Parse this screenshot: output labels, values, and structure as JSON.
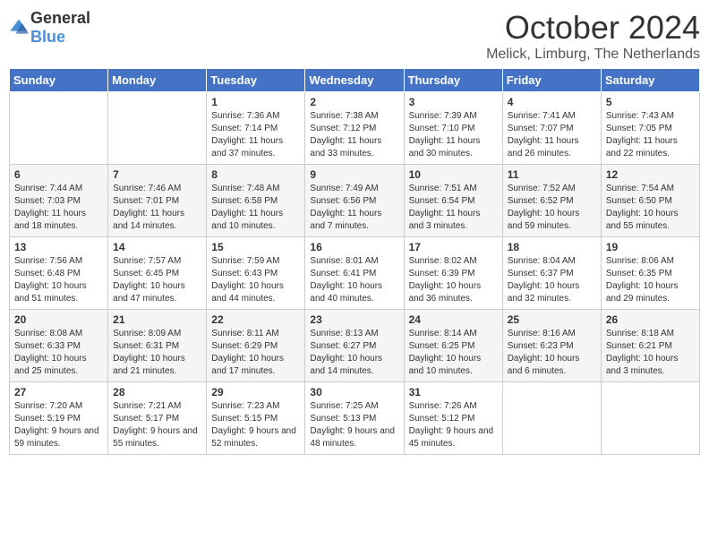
{
  "logo": {
    "general": "General",
    "blue": "Blue"
  },
  "header": {
    "month": "October 2024",
    "location": "Melick, Limburg, The Netherlands"
  },
  "weekdays": [
    "Sunday",
    "Monday",
    "Tuesday",
    "Wednesday",
    "Thursday",
    "Friday",
    "Saturday"
  ],
  "weeks": [
    [
      {
        "day": "",
        "sunrise": "",
        "sunset": "",
        "daylight": ""
      },
      {
        "day": "",
        "sunrise": "",
        "sunset": "",
        "daylight": ""
      },
      {
        "day": "1",
        "sunrise": "Sunrise: 7:36 AM",
        "sunset": "Sunset: 7:14 PM",
        "daylight": "Daylight: 11 hours and 37 minutes."
      },
      {
        "day": "2",
        "sunrise": "Sunrise: 7:38 AM",
        "sunset": "Sunset: 7:12 PM",
        "daylight": "Daylight: 11 hours and 33 minutes."
      },
      {
        "day": "3",
        "sunrise": "Sunrise: 7:39 AM",
        "sunset": "Sunset: 7:10 PM",
        "daylight": "Daylight: 11 hours and 30 minutes."
      },
      {
        "day": "4",
        "sunrise": "Sunrise: 7:41 AM",
        "sunset": "Sunset: 7:07 PM",
        "daylight": "Daylight: 11 hours and 26 minutes."
      },
      {
        "day": "5",
        "sunrise": "Sunrise: 7:43 AM",
        "sunset": "Sunset: 7:05 PM",
        "daylight": "Daylight: 11 hours and 22 minutes."
      }
    ],
    [
      {
        "day": "6",
        "sunrise": "Sunrise: 7:44 AM",
        "sunset": "Sunset: 7:03 PM",
        "daylight": "Daylight: 11 hours and 18 minutes."
      },
      {
        "day": "7",
        "sunrise": "Sunrise: 7:46 AM",
        "sunset": "Sunset: 7:01 PM",
        "daylight": "Daylight: 11 hours and 14 minutes."
      },
      {
        "day": "8",
        "sunrise": "Sunrise: 7:48 AM",
        "sunset": "Sunset: 6:58 PM",
        "daylight": "Daylight: 11 hours and 10 minutes."
      },
      {
        "day": "9",
        "sunrise": "Sunrise: 7:49 AM",
        "sunset": "Sunset: 6:56 PM",
        "daylight": "Daylight: 11 hours and 7 minutes."
      },
      {
        "day": "10",
        "sunrise": "Sunrise: 7:51 AM",
        "sunset": "Sunset: 6:54 PM",
        "daylight": "Daylight: 11 hours and 3 minutes."
      },
      {
        "day": "11",
        "sunrise": "Sunrise: 7:52 AM",
        "sunset": "Sunset: 6:52 PM",
        "daylight": "Daylight: 10 hours and 59 minutes."
      },
      {
        "day": "12",
        "sunrise": "Sunrise: 7:54 AM",
        "sunset": "Sunset: 6:50 PM",
        "daylight": "Daylight: 10 hours and 55 minutes."
      }
    ],
    [
      {
        "day": "13",
        "sunrise": "Sunrise: 7:56 AM",
        "sunset": "Sunset: 6:48 PM",
        "daylight": "Daylight: 10 hours and 51 minutes."
      },
      {
        "day": "14",
        "sunrise": "Sunrise: 7:57 AM",
        "sunset": "Sunset: 6:45 PM",
        "daylight": "Daylight: 10 hours and 47 minutes."
      },
      {
        "day": "15",
        "sunrise": "Sunrise: 7:59 AM",
        "sunset": "Sunset: 6:43 PM",
        "daylight": "Daylight: 10 hours and 44 minutes."
      },
      {
        "day": "16",
        "sunrise": "Sunrise: 8:01 AM",
        "sunset": "Sunset: 6:41 PM",
        "daylight": "Daylight: 10 hours and 40 minutes."
      },
      {
        "day": "17",
        "sunrise": "Sunrise: 8:02 AM",
        "sunset": "Sunset: 6:39 PM",
        "daylight": "Daylight: 10 hours and 36 minutes."
      },
      {
        "day": "18",
        "sunrise": "Sunrise: 8:04 AM",
        "sunset": "Sunset: 6:37 PM",
        "daylight": "Daylight: 10 hours and 32 minutes."
      },
      {
        "day": "19",
        "sunrise": "Sunrise: 8:06 AM",
        "sunset": "Sunset: 6:35 PM",
        "daylight": "Daylight: 10 hours and 29 minutes."
      }
    ],
    [
      {
        "day": "20",
        "sunrise": "Sunrise: 8:08 AM",
        "sunset": "Sunset: 6:33 PM",
        "daylight": "Daylight: 10 hours and 25 minutes."
      },
      {
        "day": "21",
        "sunrise": "Sunrise: 8:09 AM",
        "sunset": "Sunset: 6:31 PM",
        "daylight": "Daylight: 10 hours and 21 minutes."
      },
      {
        "day": "22",
        "sunrise": "Sunrise: 8:11 AM",
        "sunset": "Sunset: 6:29 PM",
        "daylight": "Daylight: 10 hours and 17 minutes."
      },
      {
        "day": "23",
        "sunrise": "Sunrise: 8:13 AM",
        "sunset": "Sunset: 6:27 PM",
        "daylight": "Daylight: 10 hours and 14 minutes."
      },
      {
        "day": "24",
        "sunrise": "Sunrise: 8:14 AM",
        "sunset": "Sunset: 6:25 PM",
        "daylight": "Daylight: 10 hours and 10 minutes."
      },
      {
        "day": "25",
        "sunrise": "Sunrise: 8:16 AM",
        "sunset": "Sunset: 6:23 PM",
        "daylight": "Daylight: 10 hours and 6 minutes."
      },
      {
        "day": "26",
        "sunrise": "Sunrise: 8:18 AM",
        "sunset": "Sunset: 6:21 PM",
        "daylight": "Daylight: 10 hours and 3 minutes."
      }
    ],
    [
      {
        "day": "27",
        "sunrise": "Sunrise: 7:20 AM",
        "sunset": "Sunset: 5:19 PM",
        "daylight": "Daylight: 9 hours and 59 minutes."
      },
      {
        "day": "28",
        "sunrise": "Sunrise: 7:21 AM",
        "sunset": "Sunset: 5:17 PM",
        "daylight": "Daylight: 9 hours and 55 minutes."
      },
      {
        "day": "29",
        "sunrise": "Sunrise: 7:23 AM",
        "sunset": "Sunset: 5:15 PM",
        "daylight": "Daylight: 9 hours and 52 minutes."
      },
      {
        "day": "30",
        "sunrise": "Sunrise: 7:25 AM",
        "sunset": "Sunset: 5:13 PM",
        "daylight": "Daylight: 9 hours and 48 minutes."
      },
      {
        "day": "31",
        "sunrise": "Sunrise: 7:26 AM",
        "sunset": "Sunset: 5:12 PM",
        "daylight": "Daylight: 9 hours and 45 minutes."
      },
      {
        "day": "",
        "sunrise": "",
        "sunset": "",
        "daylight": ""
      },
      {
        "day": "",
        "sunrise": "",
        "sunset": "",
        "daylight": ""
      }
    ]
  ]
}
